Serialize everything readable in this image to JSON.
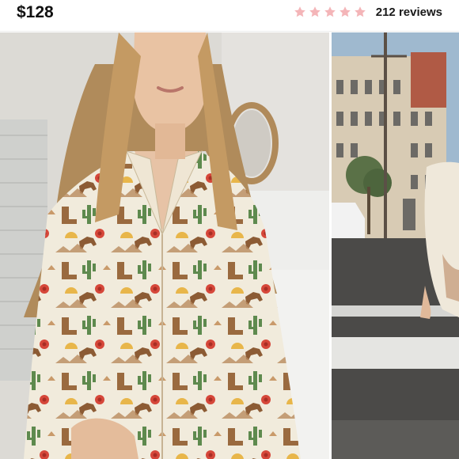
{
  "product": {
    "price": "$128",
    "rating": {
      "value": 5,
      "max": 5,
      "star_color": "#f4b5b8",
      "reviews_text": "212 reviews"
    }
  },
  "gallery": {
    "images": [
      {
        "icon": "model-photo-cowboy-print-shirt"
      },
      {
        "icon": "street-photo-model"
      }
    ]
  }
}
